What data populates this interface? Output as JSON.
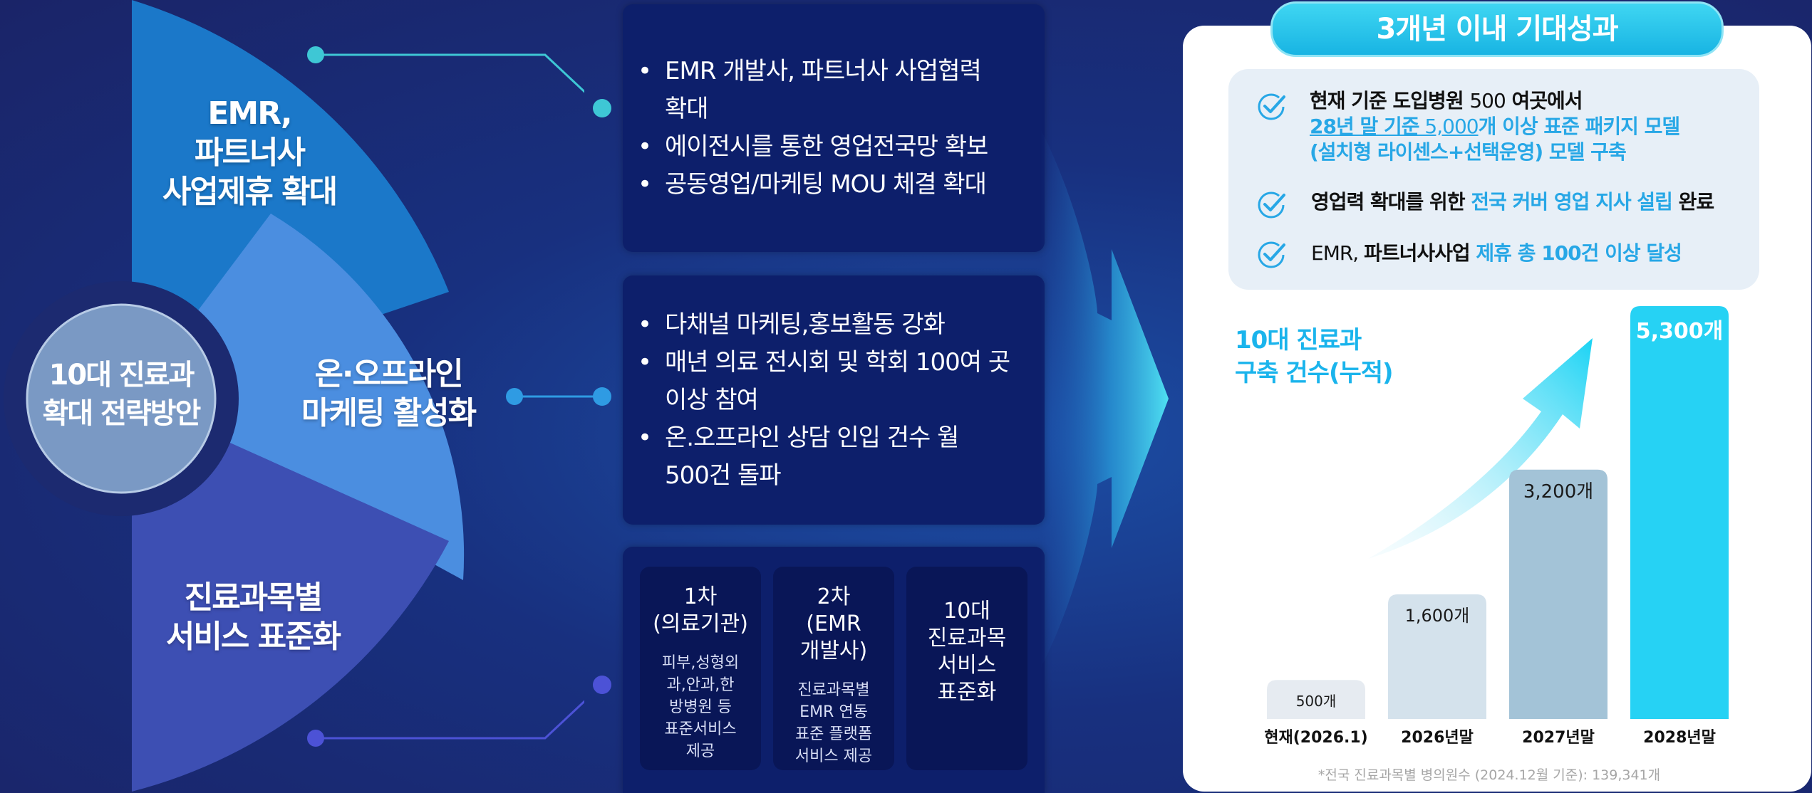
{
  "left": {
    "center_label": [
      "10대 진료과",
      "확대 전략방안"
    ],
    "segments": [
      {
        "label": [
          "EMR,",
          "파트너사",
          "사업제휴 확대"
        ],
        "color": "#1b78c9"
      },
      {
        "label": [
          "온·오프라인",
          "마케팅 활성화"
        ],
        "color": "#4b8ee0"
      },
      {
        "label": [
          "진료과목별",
          "서비스 표준화"
        ],
        "color": "#3d4fb3"
      }
    ]
  },
  "panels": [
    {
      "items": [
        "EMR 개발사, 파트너사 사업협력",
        "확대",
        "에이전시를 통한 영업전국망 확보",
        "공동영업/마케팅 MOU 체결 확대"
      ]
    },
    {
      "items": [
        "다채널 마케팅,홍보활동 강화",
        "매년 의료 전시회 및 학회 100여 곳",
        "이상 참여",
        "온.오프라인 상담 인입 건수 월",
        "500건 돌파"
      ]
    }
  ],
  "cards": [
    {
      "title": [
        "1차",
        "(의료기관)"
      ],
      "sub": [
        "피부,성형외",
        "과,안과,한",
        "방병원 등",
        "표준서비스",
        "제공"
      ]
    },
    {
      "title": [
        "2차",
        "(EMR",
        "개발사)"
      ],
      "sub": [
        "진료과목별",
        "EMR 연동",
        "표준 플랫폼",
        "서비스 제공"
      ]
    },
    {
      "title": [
        "10대",
        "진료과목",
        "서비스",
        "표준화"
      ],
      "sub": []
    }
  ],
  "result": {
    "title": "3개년 이내 기대성과",
    "goal1": {
      "a": "현재 기준 도입병원 ",
      "b": "500",
      "c": " 여곳에서",
      "d": "28년 말 기준",
      "e": " 5,000",
      "f": "개 이상 표준 패키지 모델",
      "g": "(설치형 라이센스+선택운영) 모델 구축"
    },
    "goal2": {
      "a": "영업력 확대를 위한 ",
      "b": "전국 커버 영업 지사 설립",
      "c": " 완료"
    },
    "goal3": {
      "a": "EMR, ",
      "b": "파트너사사업 ",
      "c": "제휴 총 100건 이상 달성"
    },
    "footnote": "*전국 진료과목별 병의원수 (2024.12월 기준): 139,341개"
  },
  "chart_data": {
    "type": "bar",
    "title": [
      "10대 진료과",
      "구축 건수(누적)"
    ],
    "categories": [
      "현재(2026.1)",
      "2026년말",
      "2027년말",
      "2028년말"
    ],
    "values": [
      500,
      1600,
      3200,
      5300
    ],
    "value_labels": [
      "500개",
      "1,600개",
      "3,200개",
      "5,300개"
    ],
    "colors": [
      "#e6ebf1",
      "#d4e2ec",
      "#a3c3d7",
      "#26d2f4"
    ],
    "ylim": [
      0,
      5300
    ]
  }
}
